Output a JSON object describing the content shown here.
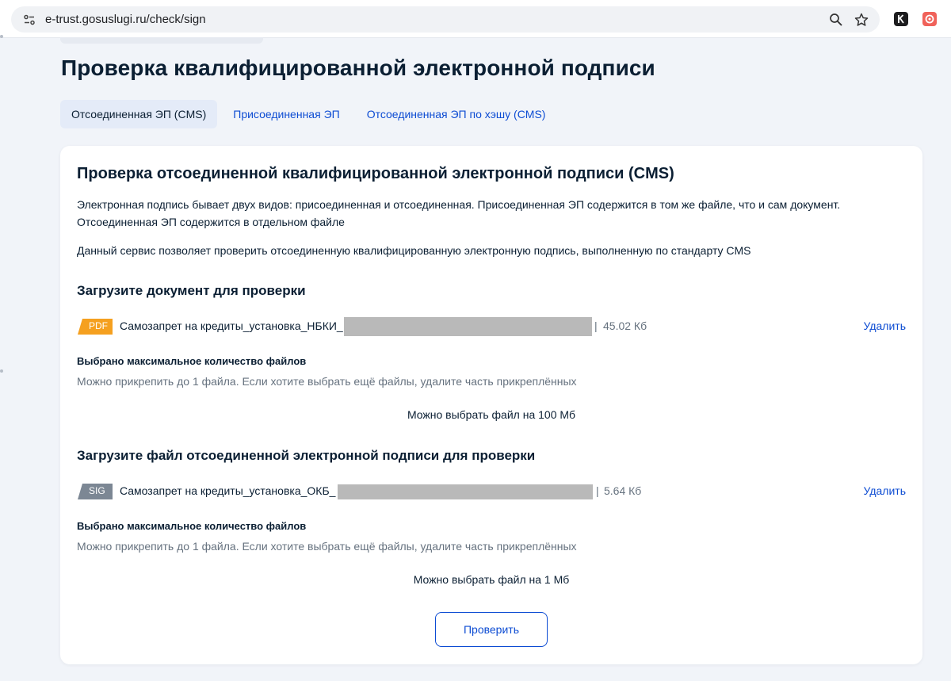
{
  "browser": {
    "url": "e-trust.gosuslugi.ru/check/sign",
    "icons": [
      "site-info-icon",
      "zoom-icon",
      "bookmark-star-icon",
      "extension-k-icon",
      "extension-red-icon"
    ]
  },
  "page": {
    "title": "Проверка квалифицированной электронной подписи",
    "tabs": [
      {
        "label": "Отсоединенная ЭП (CMS)",
        "active": true
      },
      {
        "label": "Присоединенная ЭП",
        "active": false
      },
      {
        "label": "Отсоединенная ЭП по хэшу (CMS)",
        "active": false
      }
    ]
  },
  "card": {
    "title": "Проверка отсоединенной квалифицированной электронной подписи (CMS)",
    "description_line1": "Электронная подпись бывает двух видов: присоединенная и отсоединенная. Присоединенная ЭП содержится в том же файле, что и сам документ.",
    "description_line2": "Отсоединенная ЭП содержится в отдельном файле",
    "service_text": "Данный сервис позволяет проверить отсоединенную квалифицированную электронную подпись, выполненную по стандарту CMS",
    "document_section": {
      "title": "Загрузите документ для проверки",
      "file": {
        "type": "PDF",
        "name": "Самозапрет на кредиты_установка_НБКИ_",
        "separator": "|",
        "size": "45.02 Кб",
        "delete_label": "Удалить"
      },
      "max_title": "Выбрано максимальное количество файлов",
      "max_text": "Можно прикрепить до 1 файла. Если хотите выбрать ещё файлы, удалите часть прикреплённых",
      "limit": "Можно выбрать файл на 100 Мб"
    },
    "signature_section": {
      "title": "Загрузите файл отсоединенной электронной подписи для проверки",
      "file": {
        "type": "SIG",
        "name": "Самозапрет на кредиты_установка_ОКБ_",
        "separator": "|",
        "size": "5.64 Кб",
        "delete_label": "Удалить"
      },
      "max_title": "Выбрано максимальное количество файлов",
      "max_text": "Можно прикрепить до 1 файла. Если хотите выбрать ещё файлы, удалите часть прикреплённых",
      "limit": "Можно выбрать файл на 1 Мб"
    },
    "check_button": "Проверить"
  },
  "colors": {
    "pdf_badge": "#f5a01f",
    "sig_badge": "#7c8794",
    "link": "#0d4cd3",
    "page_bg": "#f1f4f9"
  }
}
